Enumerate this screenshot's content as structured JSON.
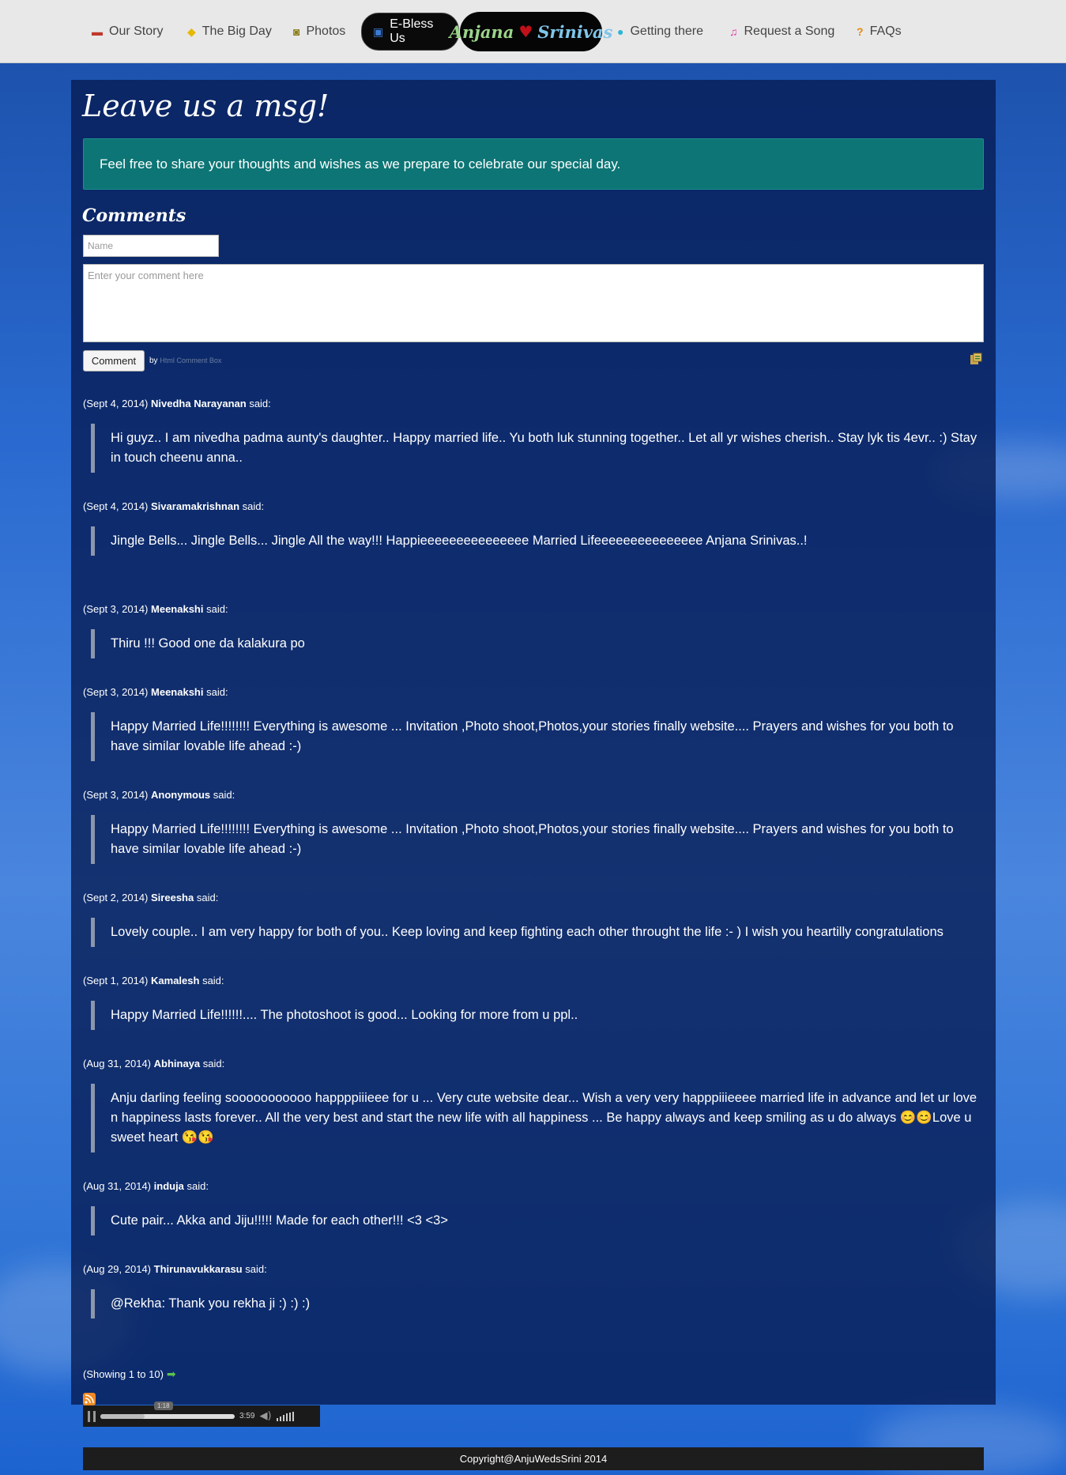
{
  "nav": {
    "items": [
      {
        "label": "Our Story",
        "icon": "book-icon",
        "glyph": "▬",
        "color": "#c0392b"
      },
      {
        "label": "The Big Day",
        "icon": "bell-icon",
        "glyph": "🔔",
        "color": "#e6b800"
      },
      {
        "label": "Photos",
        "icon": "camera-icon",
        "glyph": "◙",
        "color": "#8a7d1a"
      },
      {
        "label": "E-Bless Us",
        "icon": "gift-icon",
        "glyph": "▣",
        "color": "#3b7bd4"
      },
      {
        "label": "Getting there",
        "icon": "map-marker-icon",
        "glyph": "⚲",
        "color": "#2bb5d8"
      },
      {
        "label": "Request a Song",
        "icon": "music-icon",
        "glyph": "♫",
        "color": "#e03a9c"
      },
      {
        "label": "FAQs",
        "icon": "question-icon",
        "glyph": "?",
        "color": "#e08a10"
      }
    ],
    "brand": {
      "left": "Anjana",
      "right": "Srinivas",
      "heart": "♥"
    }
  },
  "page": {
    "title": "Leave us a msg!",
    "notice": "Feel free to share your thoughts and wishes as we prepare to celebrate our special day.",
    "comments_heading": "Comments"
  },
  "form": {
    "name_placeholder": "Name",
    "comment_placeholder": "Enter your comment here",
    "submit_label": "Comment",
    "by_text": "by",
    "by_link": "Html Comment Box"
  },
  "comments": [
    {
      "date": "(Sept 4, 2014)",
      "author": "Nivedha Narayanan",
      "said": "said:",
      "text": "Hi guyz.. I am nivedha padma aunty's daughter.. Happy married life.. Yu both luk stunning together.. Let all yr wishes cherish.. Stay lyk tis 4evr.. :) Stay in touch cheenu anna.."
    },
    {
      "date": "(Sept 4, 2014)",
      "author": "Sivaramakrishnan",
      "said": "said:",
      "text": "Jingle Bells... Jingle Bells... Jingle All the way!!! Happieeeeeeeeeeeeeee Married Lifeeeeeeeeeeeeeee Anjana Srinivas..!"
    },
    {
      "date": "(Sept 3, 2014)",
      "author": "Meenakshi",
      "said": "said:",
      "text": "Thiru !!! Good one da kalakura po"
    },
    {
      "date": "(Sept 3, 2014)",
      "author": "Meenakshi",
      "said": "said:",
      "text": "Happy Married Life!!!!!!!! Everything is awesome ... Invitation ,Photo shoot,Photos,your stories finally website.... Prayers and wishes for you both to have similar lovable life ahead :-)"
    },
    {
      "date": "(Sept 3, 2014)",
      "author": "Anonymous",
      "said": "said:",
      "text": "Happy Married Life!!!!!!!! Everything is awesome ... Invitation ,Photo shoot,Photos,your stories finally website.... Prayers and wishes for you both to have similar lovable life ahead :-)"
    },
    {
      "date": "(Sept 2, 2014)",
      "author": "Sireesha",
      "said": "said:",
      "text": "Lovely couple.. I am very happy for both of you.. Keep loving and keep fighting each other throught the life :- ) I wish you heartilly congratulations"
    },
    {
      "date": "(Sept 1, 2014)",
      "author": "Kamalesh",
      "said": "said:",
      "text": "Happy Married Life!!!!!!.... The photoshoot is good... Looking for more from u ppl.."
    },
    {
      "date": "(Aug 31, 2014)",
      "author": "Abhinaya",
      "said": "said:",
      "text": "Anju darling feeling sooooooooooo happppiiieee for u ... Very cute website dear... Wish a very very happpiiieeee married life in advance and let ur love n happiness lasts forever.. All the very best and start the new life with all happiness ... Be happy always and keep smiling as u do always 😊😊Love u sweet heart 😘😘"
    },
    {
      "date": "(Aug 31, 2014)",
      "author": "induja",
      "said": "said:",
      "text": "Cute pair... Akka and Jiju!!!!! Made for each other!!! <3 <3>"
    },
    {
      "date": "(Aug 29, 2014)",
      "author": "Thirunavukkarasu",
      "said": "said:",
      "text": "@Rekha: Thank you rekha ji :) :) :)"
    }
  ],
  "pagination": {
    "text": "(Showing 1 to 10)",
    "next_icon": "➡"
  },
  "player": {
    "tooltip": "1:18",
    "duration": "3:59",
    "progress": 0.33
  },
  "footer": {
    "text": "Copyright@AnjuWedsSrini 2014"
  }
}
